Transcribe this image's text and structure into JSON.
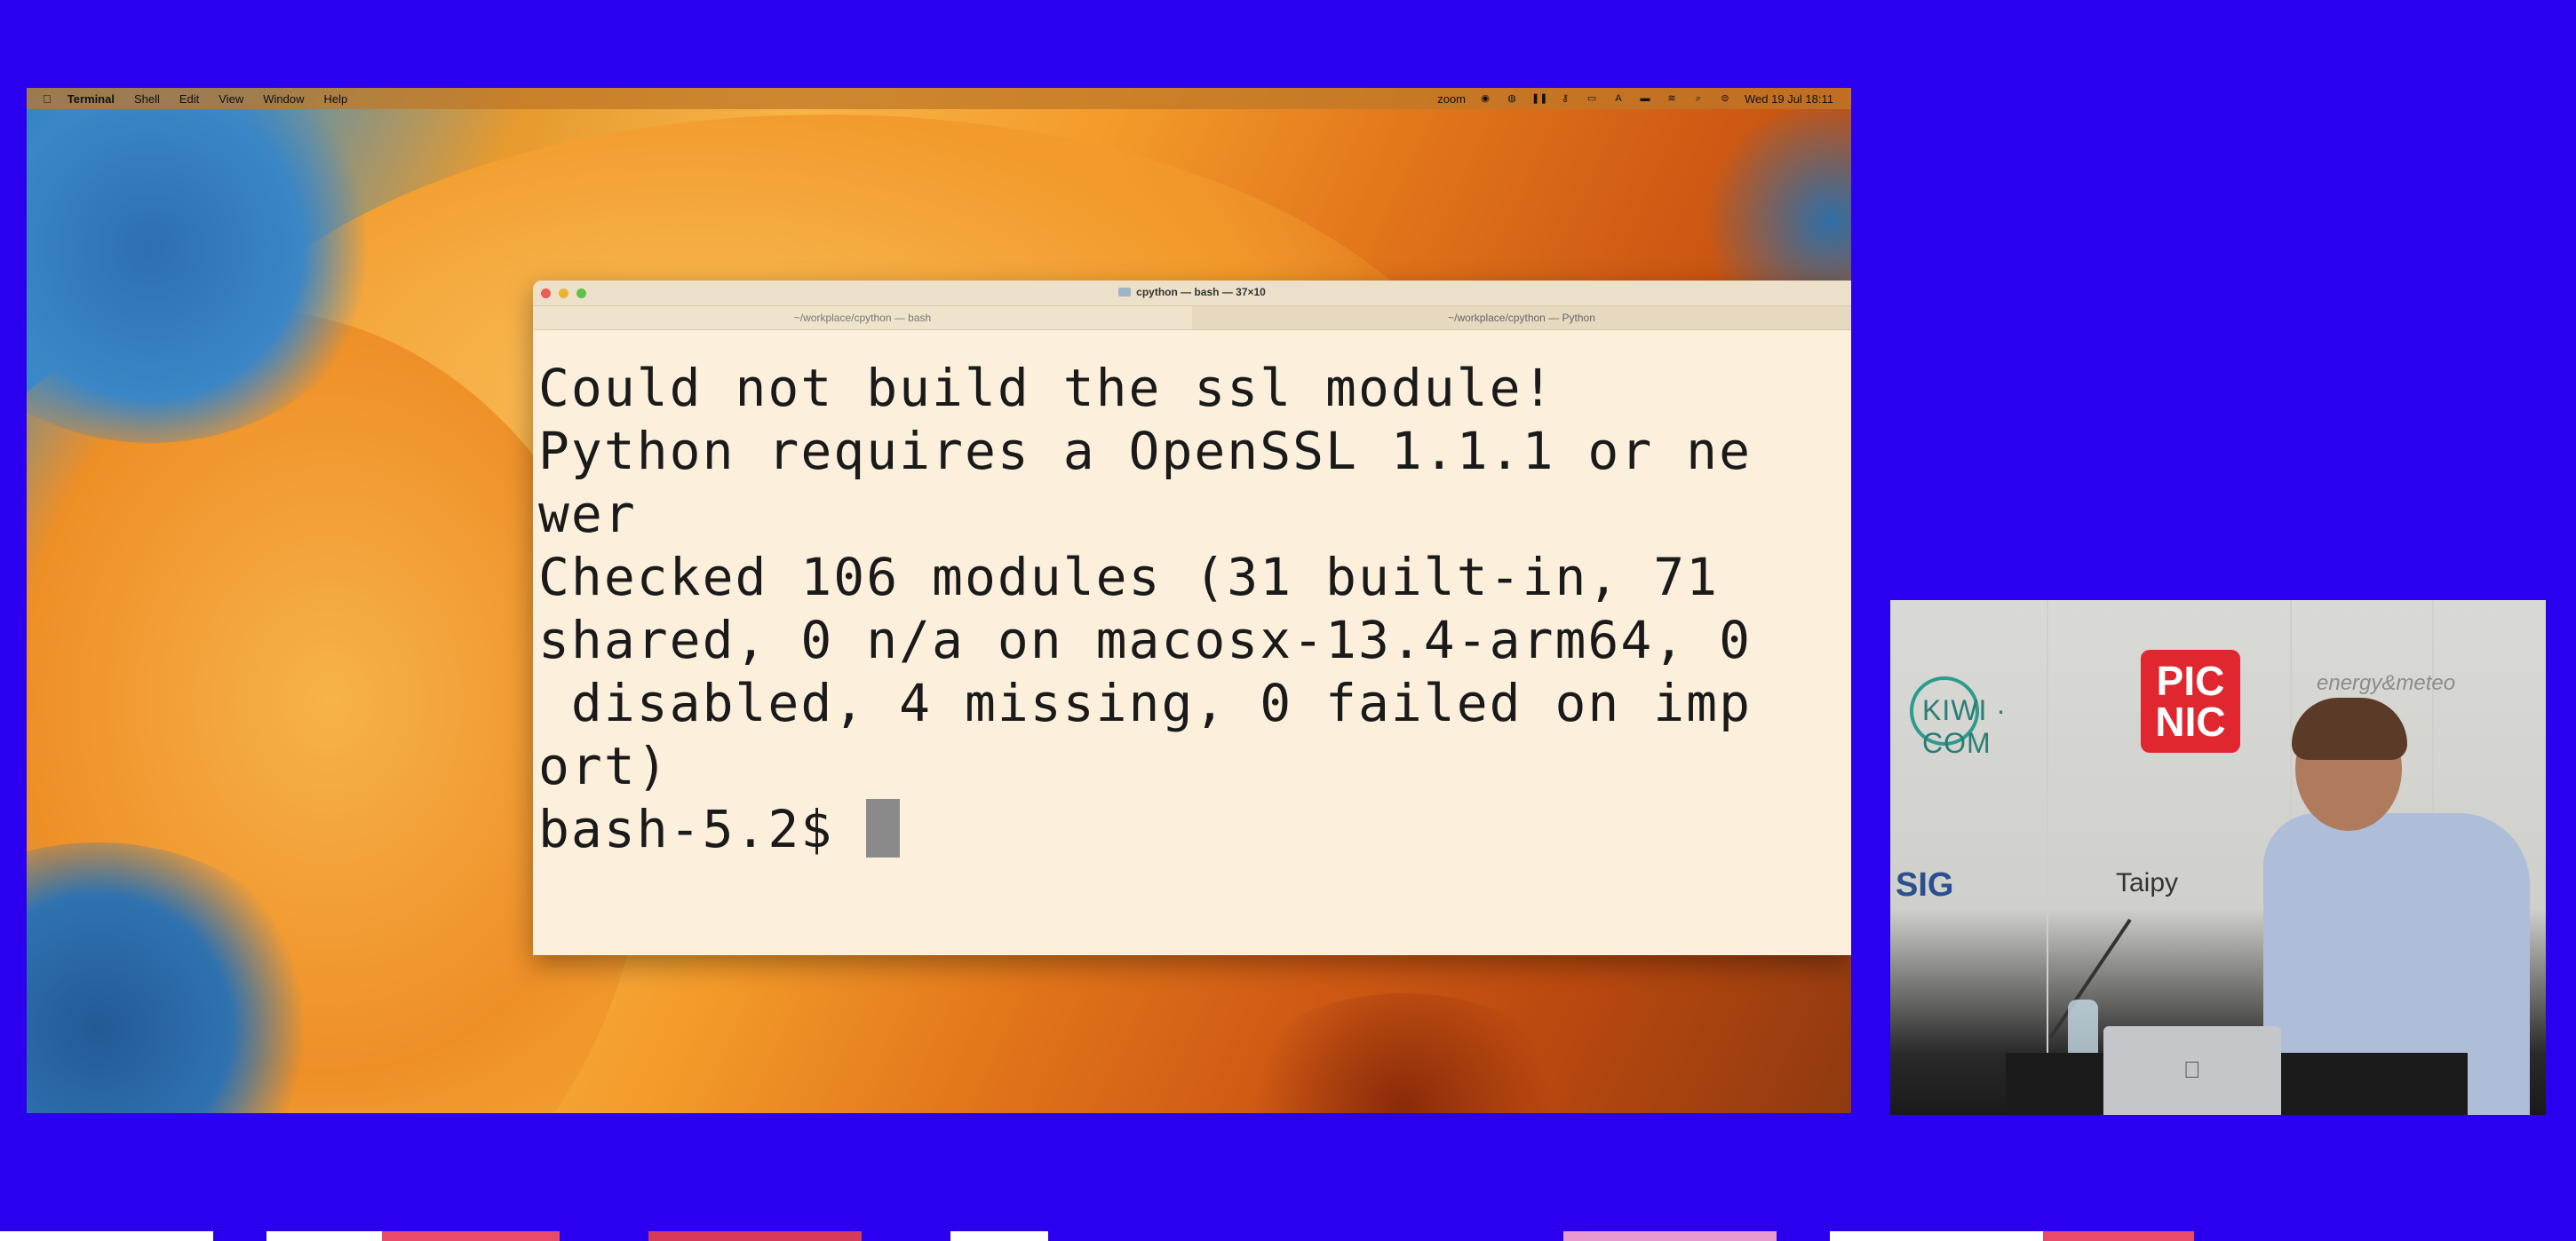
{
  "menubar": {
    "apple": "",
    "app_name": "Terminal",
    "menus": [
      "Shell",
      "Edit",
      "View",
      "Window",
      "Help"
    ],
    "status_zoom": "zoom",
    "datetime": "Wed 19 Jul  18:11"
  },
  "terminal": {
    "window_title": "cpython — bash — 37×10",
    "tabs": [
      {
        "label": "~/workplace/cpython — bash"
      },
      {
        "label": "~/workplace/cpython — Python"
      }
    ],
    "lines": [
      "Could not build the ssl module!",
      "Python requires a OpenSSL 1.1.1 or ne",
      "wer",
      "",
      "Checked 106 modules (31 built-in, 71 ",
      "shared, 0 n/a on macosx-13.4-arm64, 0",
      " disabled, 4 missing, 0 failed on imp",
      "ort)"
    ],
    "prompt": "bash-5.2$ "
  },
  "camera": {
    "sponsor_kiwi": "KIWI · COM",
    "sponsor_picnic": "PIC\nNIC",
    "sponsor_energy": "energy&meteo",
    "sponsor_sig": "SIG",
    "sponsor_taipy": "Taipy"
  },
  "colors": {
    "background": "#2a00ee",
    "terminal_bg": "#fcf0dc",
    "terminal_text": "#1a1a1a"
  }
}
